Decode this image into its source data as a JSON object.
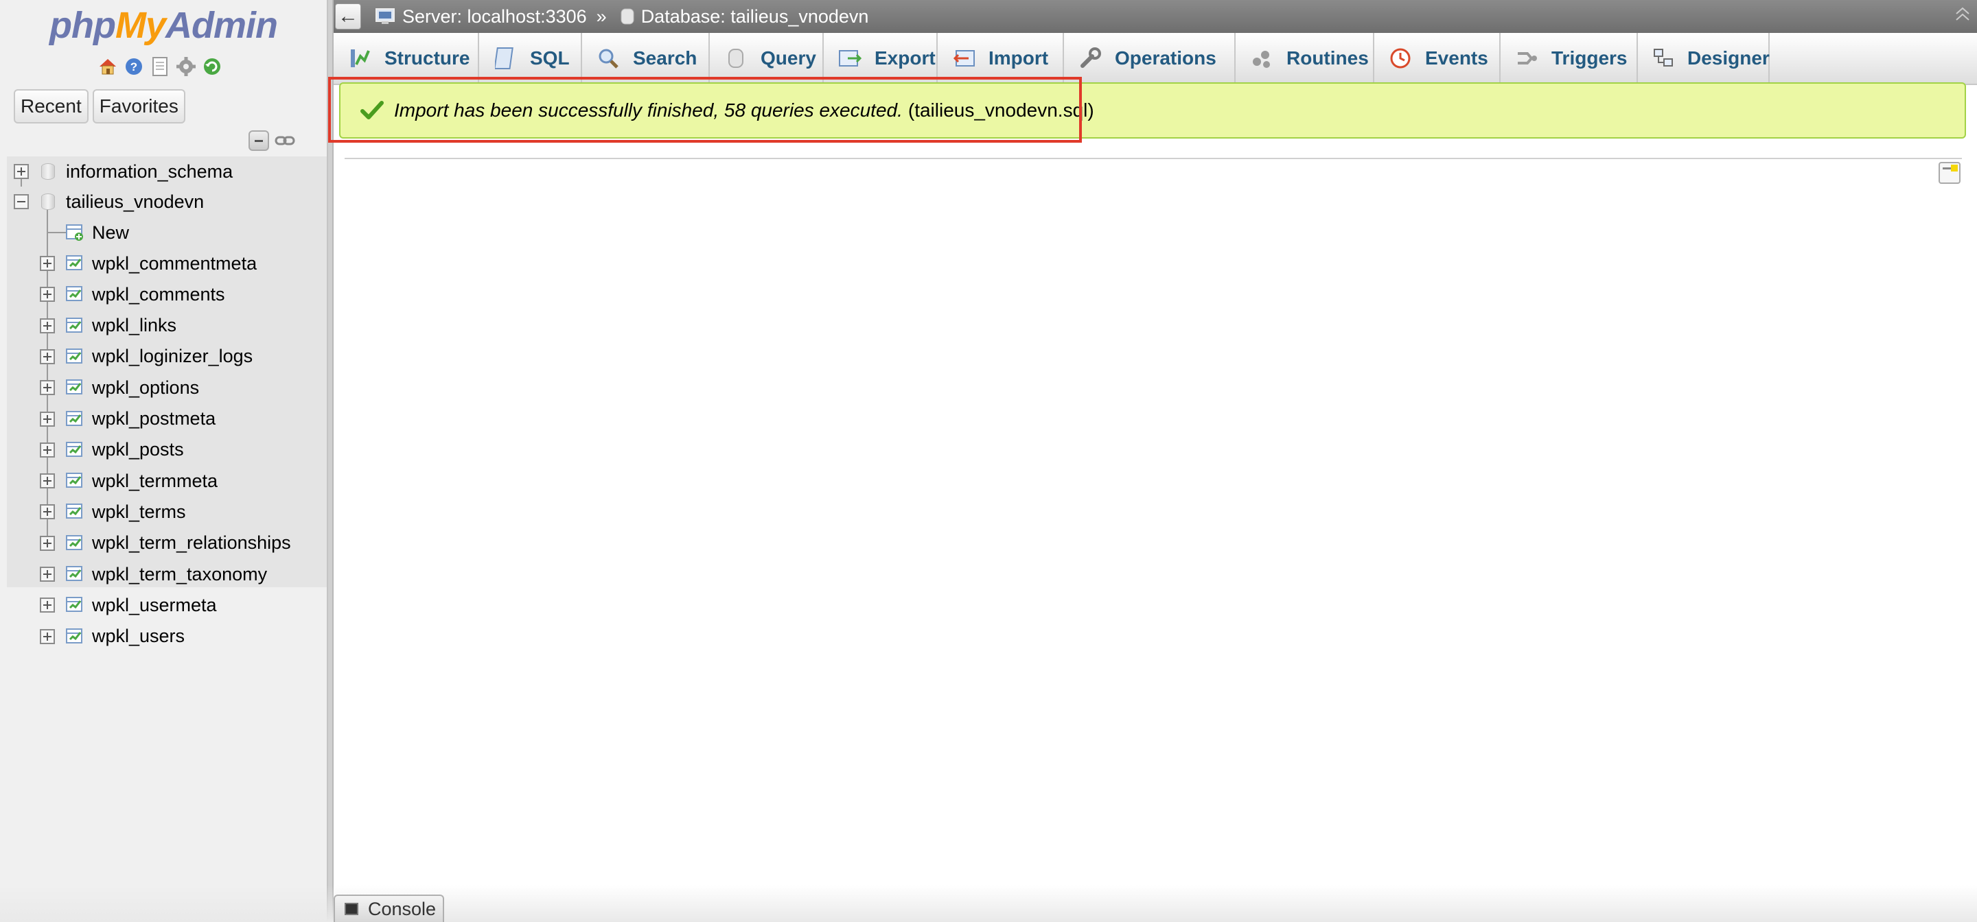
{
  "logo": {
    "php": "php",
    "my": "My",
    "admin": "Admin"
  },
  "sidebar": {
    "quick_icons": [
      "home-icon",
      "help-icon",
      "docs-icon",
      "settings-icon",
      "reload-icon"
    ],
    "recent_label": "Recent",
    "favorites_label": "Favorites",
    "databases": [
      {
        "name": "information_schema",
        "expanded": false
      },
      {
        "name": "tailieus_vnodevn",
        "expanded": true,
        "new_label": "New",
        "tables": [
          "wpkl_commentmeta",
          "wpkl_comments",
          "wpkl_links",
          "wpkl_loginizer_logs",
          "wpkl_options",
          "wpkl_postmeta",
          "wpkl_posts",
          "wpkl_termmeta",
          "wpkl_terms",
          "wpkl_term_relationships",
          "wpkl_term_taxonomy",
          "wpkl_usermeta",
          "wpkl_users"
        ]
      }
    ]
  },
  "breadcrumb": {
    "back_label": "←",
    "server": "Server: localhost:3306",
    "separator": "»",
    "database": "Database: tailieus_vnodevn"
  },
  "menu": [
    {
      "label": "Structure",
      "icon": "structure-icon"
    },
    {
      "label": "SQL",
      "icon": "sql-icon"
    },
    {
      "label": "Search",
      "icon": "search-icon"
    },
    {
      "label": "Query",
      "icon": "query-icon"
    },
    {
      "label": "Export",
      "icon": "export-icon"
    },
    {
      "label": "Import",
      "icon": "import-icon"
    },
    {
      "label": "Operations",
      "icon": "wrench-icon"
    },
    {
      "label": "Routines",
      "icon": "routines-icon"
    },
    {
      "label": "Events",
      "icon": "events-icon"
    },
    {
      "label": "Triggers",
      "icon": "triggers-icon"
    },
    {
      "label": "Designer",
      "icon": "designer-icon"
    }
  ],
  "notice": {
    "message": "Import has been successfully finished, 58 queries executed.",
    "filename": "(tailieus_vnodevn.sql)",
    "color": "#ebf8a4",
    "highlight_color": "#e03a2a"
  },
  "console": {
    "label": "Console"
  }
}
